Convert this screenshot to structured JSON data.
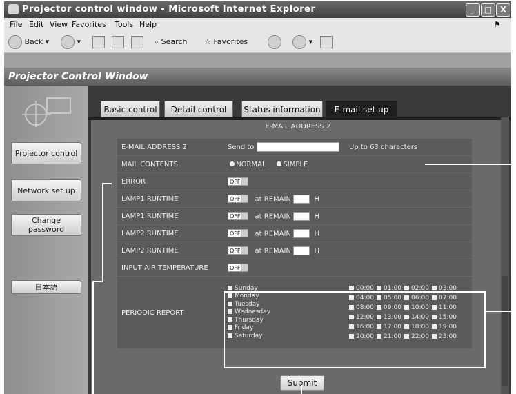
{
  "window": {
    "title": "Projector control window - Microsoft Internet Explorer",
    "controls": [
      "_",
      "□",
      "X"
    ]
  },
  "menu": [
    "File",
    "Edit",
    "View",
    "Favorites",
    "Tools",
    "Help"
  ],
  "toolbar": {
    "back": "Back",
    "search": "Search",
    "favorites": "Favorites"
  },
  "app": {
    "header": "Projector Control Window"
  },
  "sidebar": {
    "items": [
      "Projector control",
      "Network set up",
      "Change password",
      "日本語"
    ]
  },
  "tabs": [
    "Basic control",
    "Detail control",
    "Status information",
    "E-mail set up"
  ],
  "section": {
    "title": "E-MAIL ADDRESS 2"
  },
  "rows": {
    "email": {
      "label": "E-MAIL ADDRESS 2",
      "send_to": "Send to",
      "note": "Up to 63 characters"
    },
    "mail_contents": {
      "label": "MAIL CONTENTS",
      "normal": "NORMAL",
      "simple": "SIMPLE"
    },
    "error": {
      "label": "ERROR",
      "select": "OFF"
    },
    "lamp1a": {
      "label": "LAMP1 RUNTIME",
      "select": "OFF",
      "remain": "at REMAIN",
      "unit": "H"
    },
    "lamp1b": {
      "label": "LAMP1 RUNTIME",
      "select": "OFF",
      "remain": "at REMAIN",
      "unit": "H"
    },
    "lamp2a": {
      "label": "LAMP2 RUNTIME",
      "select": "OFF",
      "remain": "at REMAIN",
      "unit": "H"
    },
    "lamp2b": {
      "label": "LAMP2 RUNTIME",
      "select": "OFF",
      "remain": "at REMAIN",
      "unit": "H"
    },
    "air": {
      "label": "INPUT AIR TEMPERATURE",
      "select": "OFF"
    },
    "periodic": {
      "label": "PERIODIC REPORT",
      "days": [
        "Sunday",
        "Monday",
        "Tuesday",
        "Wednesday",
        "Thursday",
        "Friday",
        "Saturday"
      ],
      "hours": [
        "00:00",
        "01:00",
        "02:00",
        "03:00",
        "04:00",
        "05:00",
        "06:00",
        "07:00",
        "08:00",
        "09:00",
        "10:00",
        "11:00",
        "12:00",
        "13:00",
        "14:00",
        "15:00",
        "16:00",
        "17:00",
        "18:00",
        "19:00",
        "20:00",
        "21:00",
        "22:00",
        "23:00"
      ]
    }
  },
  "submit": "Submit"
}
